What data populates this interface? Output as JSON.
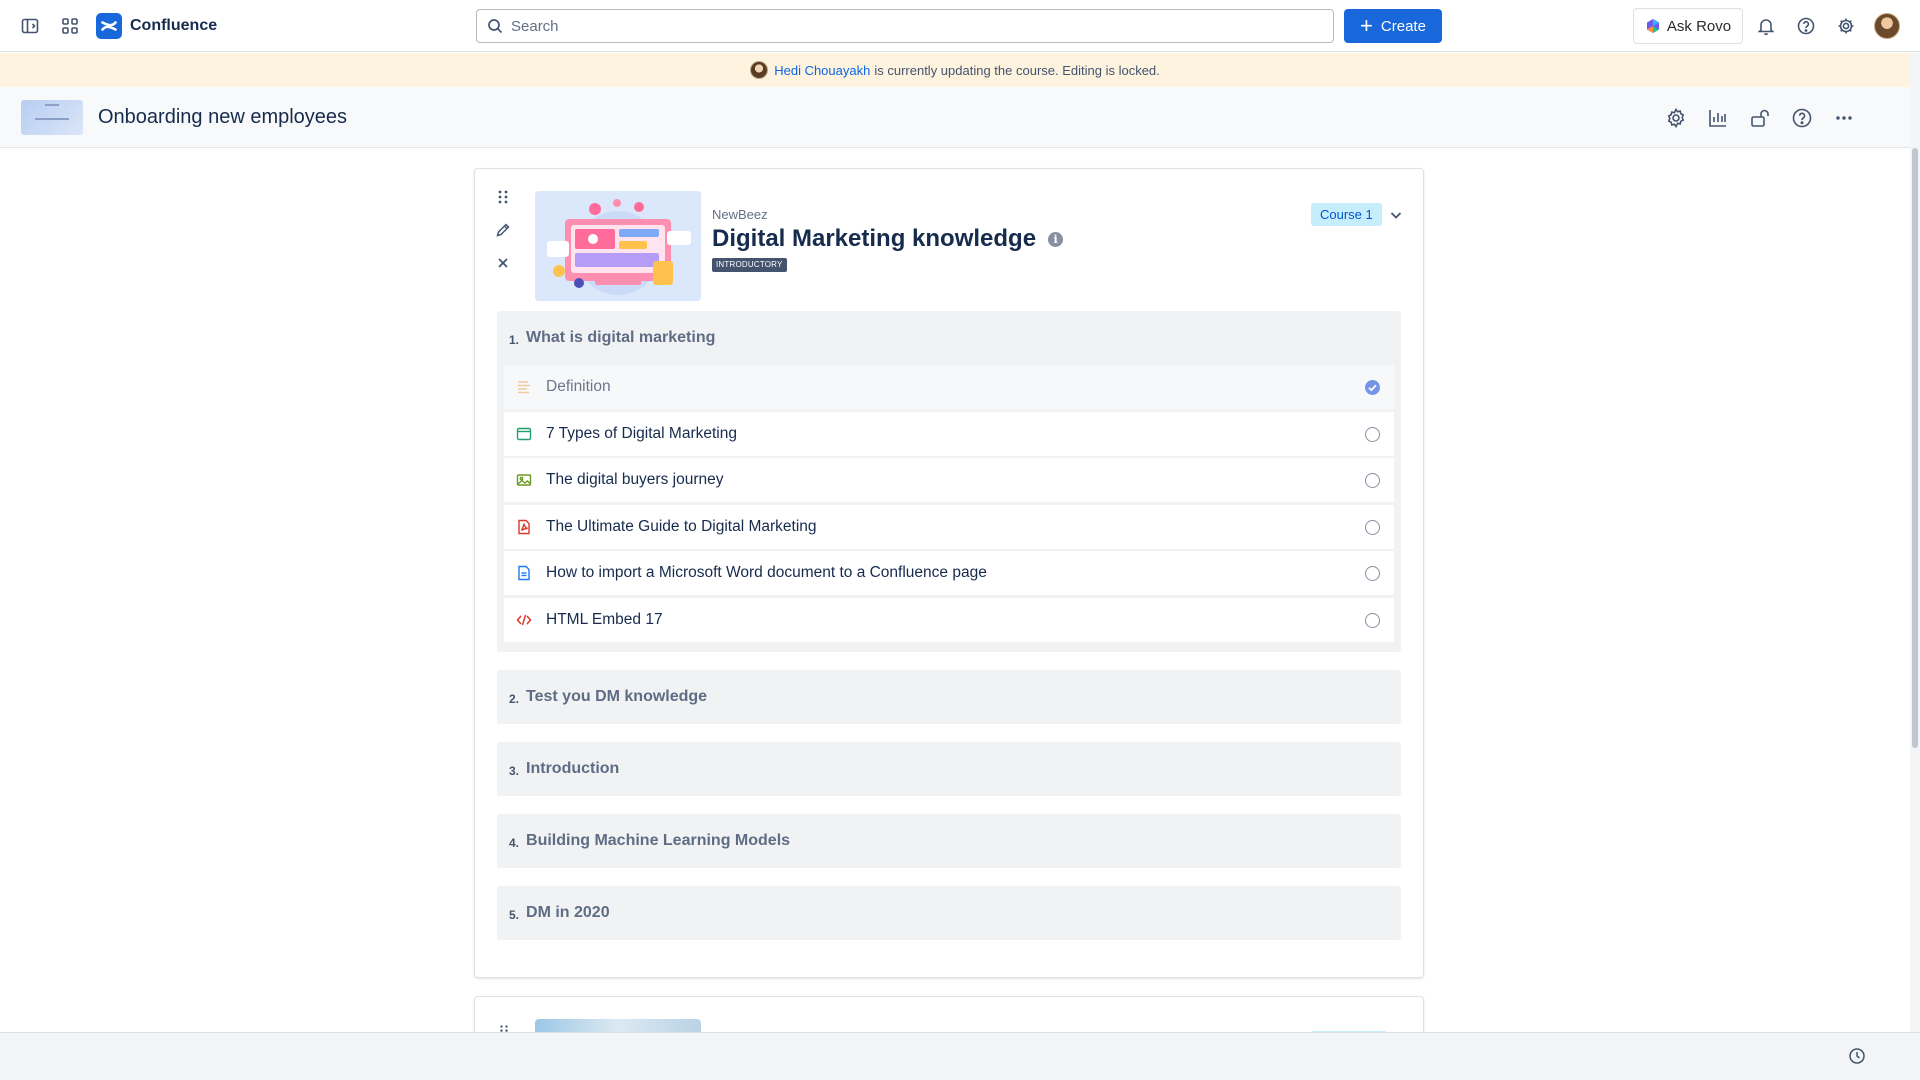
{
  "app": {
    "name": "Confluence",
    "brand_color": "#1868db"
  },
  "topnav": {
    "search_placeholder": "Search",
    "create_label": "Create",
    "ask_rovo_label": "Ask Rovo"
  },
  "banner": {
    "user_name": "Hedi Chouayakh",
    "message": "is currently updating the course. Editing is locked."
  },
  "page": {
    "title": "Onboarding new employees"
  },
  "course": {
    "organization": "NewBeez",
    "title": "Digital Marketing knowledge",
    "level": "INTRODUCTORY",
    "course_badge": "Course 1",
    "sections": [
      {
        "number": "1.",
        "name": "What is digital marketing",
        "items": [
          {
            "label": "Definition",
            "icon": "text-lines-icon",
            "completed": true
          },
          {
            "label": "7 Types of Digital Marketing",
            "icon": "browser-window-icon",
            "completed": false
          },
          {
            "label": "The digital buyers journey",
            "icon": "image-icon",
            "completed": false
          },
          {
            "label": "The Ultimate Guide to Digital Marketing",
            "icon": "pdf-file-icon",
            "completed": false
          },
          {
            "label": "How to import a Microsoft Word document to a Confluence page",
            "icon": "document-icon",
            "completed": false
          },
          {
            "label": "HTML Embed 17",
            "icon": "code-icon",
            "completed": false
          }
        ]
      },
      {
        "number": "2.",
        "name": "Test you DM knowledge"
      },
      {
        "number": "3.",
        "name": "Introduction"
      },
      {
        "number": "4.",
        "name": "Building Machine Learning Models"
      },
      {
        "number": "5.",
        "name": "DM in 2020"
      }
    ]
  }
}
